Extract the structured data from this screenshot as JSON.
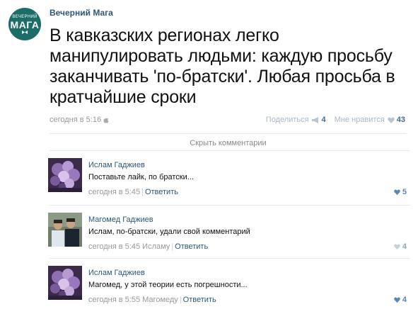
{
  "post": {
    "avatar_small": "ВЕЧЕРНИЙ",
    "avatar_big": "МАГА",
    "author": "Вечерний Мага",
    "text": "В кавказских регионах легко манипулировать людьми: каждую просьбу заканчивать 'по-братски'. Любая просьба в кратчайшие сроки",
    "date": "сегодня в 5:16",
    "share_label": "Поделиться",
    "share_count": "4",
    "like_label": "Мне нравится",
    "like_count": "43",
    "hide_comments": "Скрыть комментарии"
  },
  "comments": [
    {
      "name": "Ислам Гаджиев",
      "text": "Поставьте лайк, по братски...",
      "date": "сегодня в 5:45",
      "to": "",
      "reply": "Ответить",
      "likes": "5"
    },
    {
      "name": "Магомед Гаджиев",
      "text": "Ислам, по-братски, удали свой комментарий",
      "date": "сегодня в 5:45",
      "to": "Исламу",
      "reply": "Ответить",
      "likes": "4"
    },
    {
      "name": "Ислам Гаджиев",
      "text": "Магомед, у этой теории есть погрешности...",
      "date": "сегодня в 5:55",
      "to": "Магомеду",
      "reply": "Ответить",
      "likes": "4"
    }
  ],
  "colors": {
    "link": "#2b587a",
    "meta": "#999999",
    "avatar_bg": "#1b6e68",
    "like_active": "#5a86b3"
  }
}
